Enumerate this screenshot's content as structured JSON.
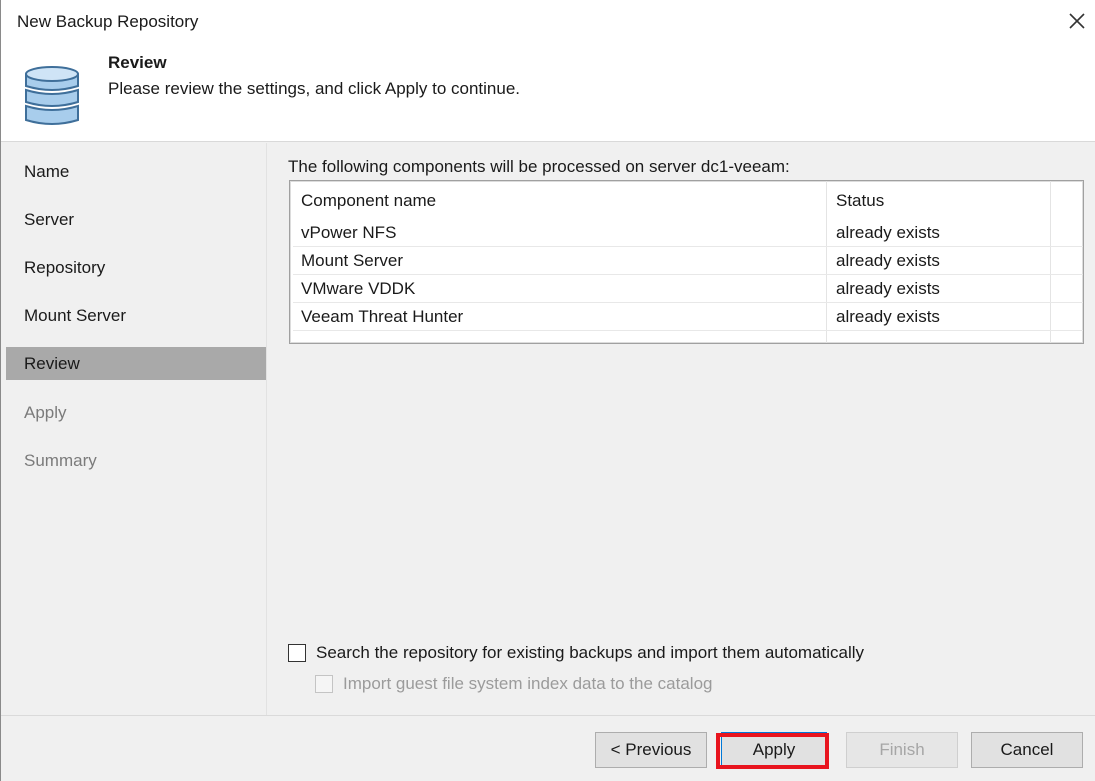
{
  "window": {
    "title": "New Backup Repository",
    "close_icon": "close-icon"
  },
  "header": {
    "icon": "database-icon",
    "title": "Review",
    "subtitle": "Please review the settings, and click Apply to continue."
  },
  "nav": {
    "items": [
      {
        "label": "Name",
        "state": "normal"
      },
      {
        "label": "Server",
        "state": "normal"
      },
      {
        "label": "Repository",
        "state": "normal"
      },
      {
        "label": "Mount Server",
        "state": "normal"
      },
      {
        "label": "Review",
        "state": "active"
      },
      {
        "label": "Apply",
        "state": "disabled"
      },
      {
        "label": "Summary",
        "state": "disabled"
      }
    ]
  },
  "content": {
    "label": "The following components will be processed on server dc1-veeam:",
    "table": {
      "columns": [
        "Component name",
        "Status"
      ],
      "rows": [
        [
          "vPower NFS",
          "already exists"
        ],
        [
          "Mount Server",
          "already exists"
        ],
        [
          "VMware VDDK",
          "already exists"
        ],
        [
          "Veeam Threat Hunter",
          "already exists"
        ]
      ]
    },
    "options": {
      "search_existing": {
        "label": "Search the repository for existing backups and import them automatically",
        "checked": false
      },
      "import_index": {
        "label": "Import guest file system index data to the catalog",
        "checked": false,
        "enabled": false
      }
    }
  },
  "footer": {
    "previous_label": "< Previous",
    "apply_label": "Apply",
    "finish_label": "Finish",
    "cancel_label": "Cancel"
  },
  "colors": {
    "active_nav": "#a9a9a9",
    "highlight": "#e8141e",
    "icon_blue": "#a8cdec"
  }
}
